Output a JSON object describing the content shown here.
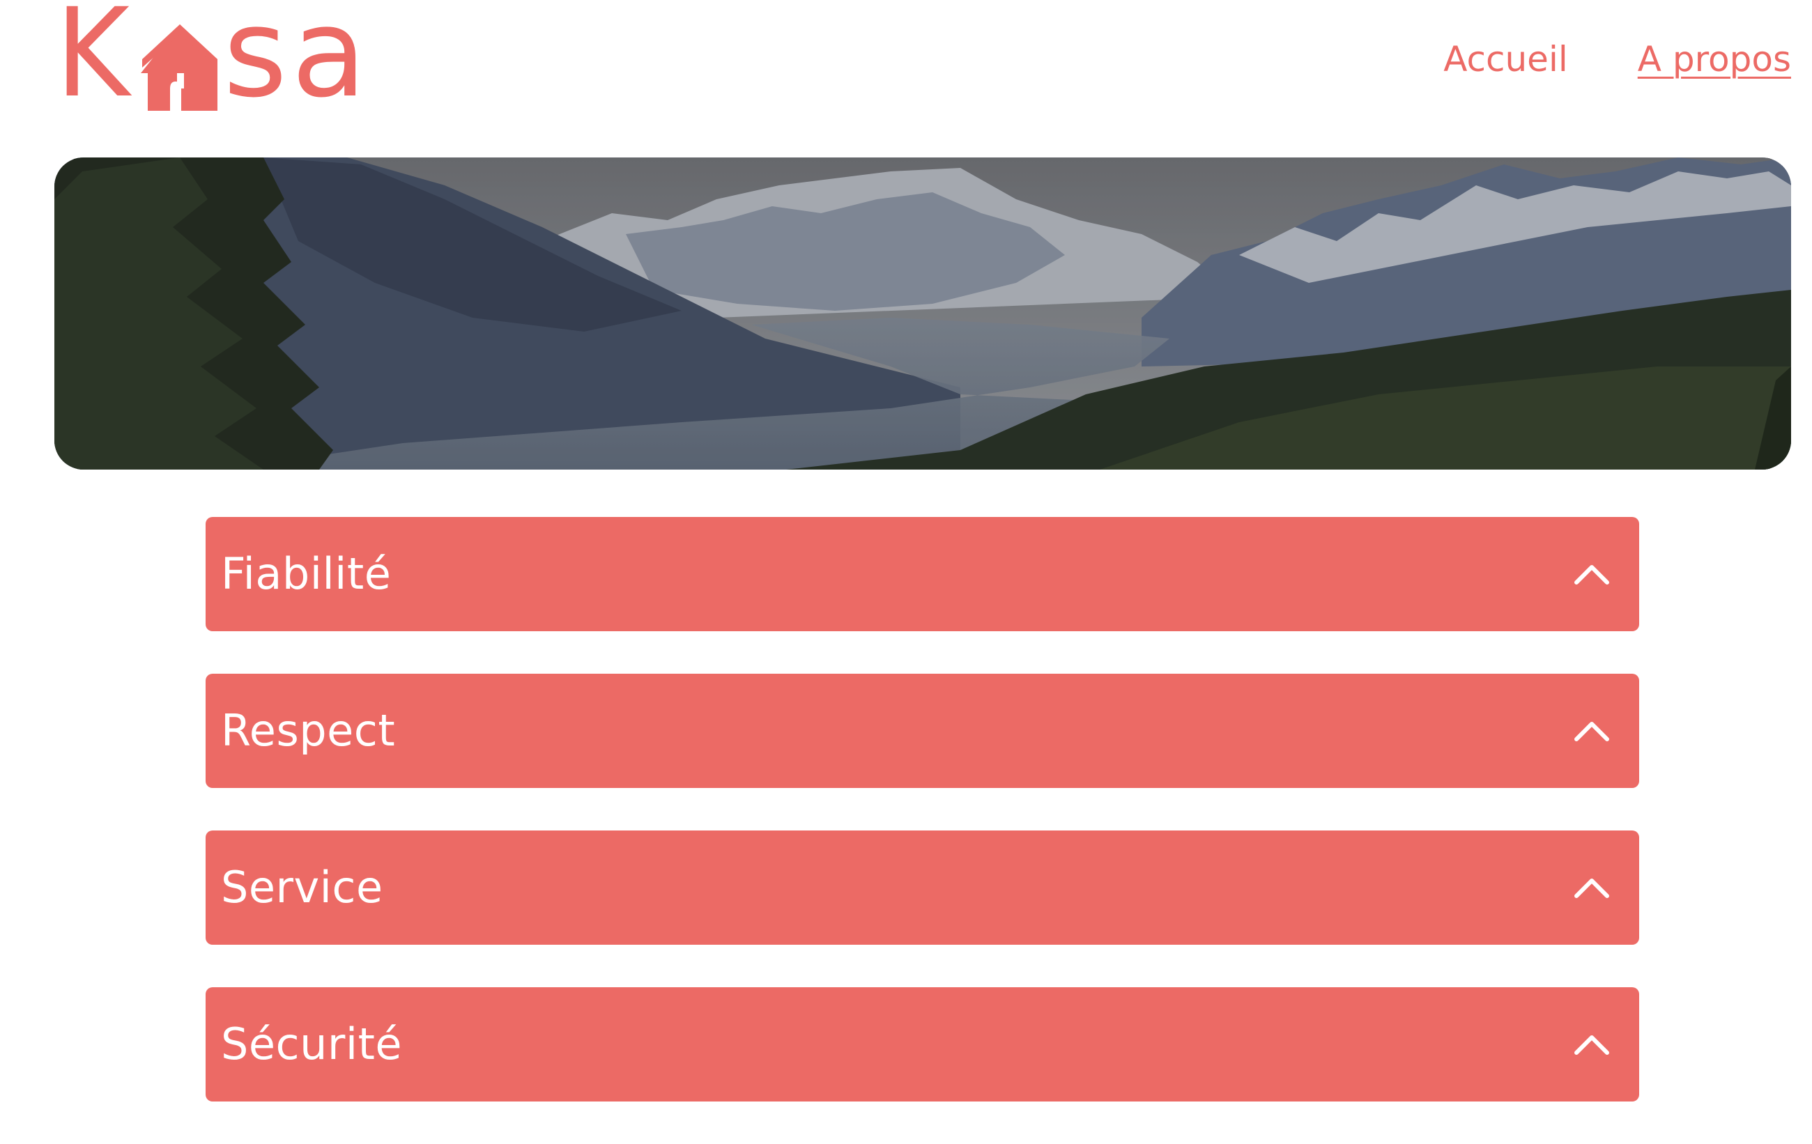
{
  "header": {
    "logo": {
      "letter_k": "K",
      "house_icon": "house-icon",
      "letters_sa": "sa"
    },
    "nav": [
      {
        "label": "Accueil",
        "active": false
      },
      {
        "label": "A propos",
        "active": true
      }
    ]
  },
  "banner": {
    "image": "mountain-landscape"
  },
  "accordion": {
    "items": [
      {
        "title": "Fiabilité",
        "icon": "chevron-up-icon"
      },
      {
        "title": "Respect",
        "icon": "chevron-up-icon"
      },
      {
        "title": "Service",
        "icon": "chevron-up-icon"
      },
      {
        "title": "Sécurité",
        "icon": "chevron-up-icon"
      }
    ]
  },
  "colors": {
    "brand": "#EC6A65",
    "white": "#FFFFFF"
  }
}
